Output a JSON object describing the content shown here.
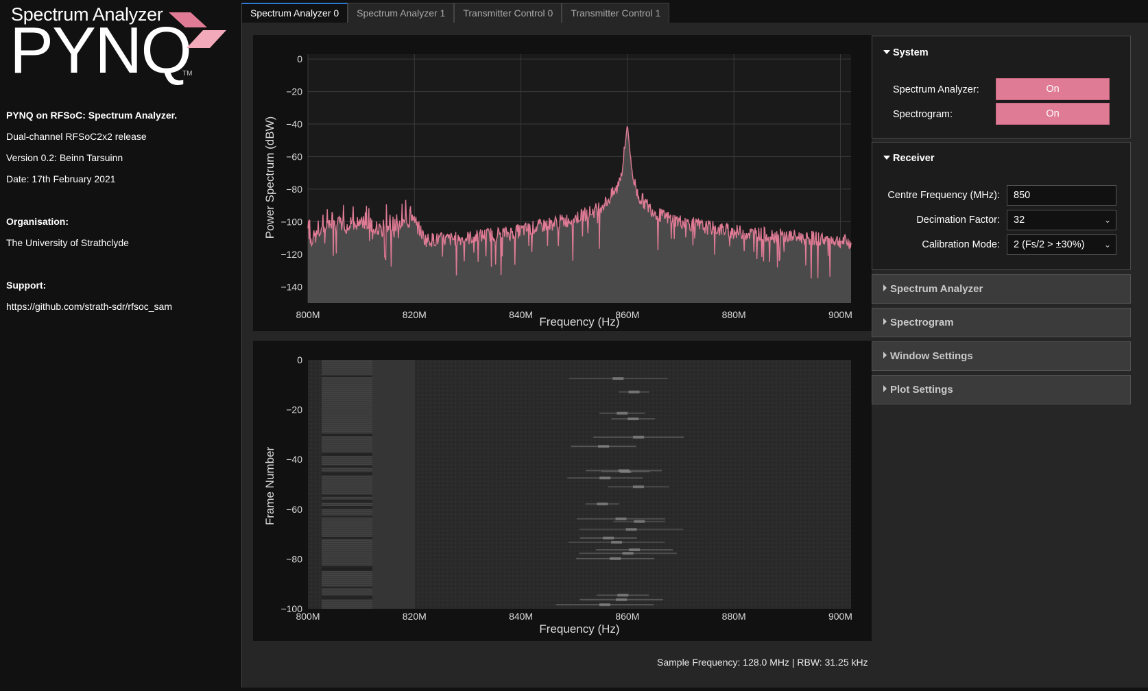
{
  "sidebar": {
    "logo_subtitle": "Spectrum Analyzer",
    "logo_title": "PYNQ",
    "logo_tm": "TM",
    "project_title": "PYNQ on RFSoC: Spectrum Analyzer.",
    "release": "Dual-channel RFSoC2x2 release",
    "version": "Version 0.2: Beinn Tarsuinn",
    "date": "Date: 17th February 2021",
    "organisation_label": "Organisation:",
    "organisation": "The University of Strathclyde",
    "support_label": "Support:",
    "support_url": "https://github.com/strath-sdr/rfsoc_sam"
  },
  "tabs": [
    {
      "label": "Spectrum Analyzer 0",
      "active": true
    },
    {
      "label": "Spectrum Analyzer 1",
      "active": false
    },
    {
      "label": "Transmitter Control 0",
      "active": false
    },
    {
      "label": "Transmitter Control 1",
      "active": false
    }
  ],
  "colors": {
    "trace": "#e07b95",
    "fill": "#4a4a4a",
    "plot_bg": "#111111",
    "panel_bg": "#262626",
    "toggle_on": "#e07b95",
    "active_tab_accent": "#2f7ad1"
  },
  "chart_data": [
    {
      "type": "line",
      "ylabel": "Power Spectrum (dBW)",
      "xlabel": "Frequency (Hz)",
      "xlim": [
        800,
        902
      ],
      "ylim": [
        -150,
        3
      ],
      "x_ticks": [
        800,
        820,
        840,
        860,
        880,
        900
      ],
      "x_tick_labels": [
        "800M",
        "820M",
        "840M",
        "860M",
        "880M",
        "900M"
      ],
      "y_ticks": [
        0,
        -20,
        -40,
        -60,
        -80,
        -100,
        -120,
        -140
      ],
      "y_tick_labels": [
        "0",
        "−20",
        "−40",
        "−60",
        "−80",
        "−100",
        "−120",
        "−140"
      ],
      "grid": true,
      "series": [
        {
          "x": [
            800,
            802,
            804,
            806,
            808,
            810,
            812,
            814,
            816,
            818,
            820,
            822,
            826,
            830,
            834,
            838,
            842,
            846,
            850,
            854,
            856,
            858,
            859,
            859.5,
            860,
            860.5,
            861,
            862,
            864,
            866,
            870,
            874,
            878,
            882,
            886,
            890,
            894,
            898,
            902
          ],
          "y": [
            -112,
            -108,
            -102,
            -101,
            -104,
            -100,
            -102,
            -106,
            -103,
            -101,
            -99,
            -111,
            -111,
            -110,
            -108,
            -107,
            -104,
            -101,
            -98,
            -93,
            -88,
            -80,
            -68,
            -55,
            -40,
            -58,
            -72,
            -84,
            -91,
            -96,
            -100,
            -103,
            -105,
            -107,
            -108,
            -109,
            -110,
            -111,
            -113
          ]
        }
      ]
    },
    {
      "type": "heatmap",
      "ylabel": "Frame Number",
      "xlabel": "Frequency (Hz)",
      "xlim": [
        800,
        902
      ],
      "ylim": [
        -100,
        0
      ],
      "x_ticks": [
        800,
        820,
        840,
        860,
        880,
        900
      ],
      "x_tick_labels": [
        "800M",
        "820M",
        "840M",
        "860M",
        "880M",
        "900M"
      ],
      "y_ticks": [
        0,
        -20,
        -40,
        -60,
        -80,
        -100
      ],
      "y_tick_labels": [
        "0",
        "−20",
        "−40",
        "−60",
        "−80",
        "−100"
      ],
      "grid": false
    }
  ],
  "status": "Sample Frequency: 128.0 MHz | RBW: 31.25 kHz",
  "system": {
    "title": "System",
    "spectrum_analyzer_label": "Spectrum Analyzer:",
    "spectrum_analyzer_value": "On",
    "spectrogram_label": "Spectrogram:",
    "spectrogram_value": "On"
  },
  "receiver": {
    "title": "Receiver",
    "centre_label": "Centre Frequency (MHz):",
    "centre_value": "850",
    "decimation_label": "Decimation Factor:",
    "decimation_value": "32",
    "calibration_label": "Calibration Mode:",
    "calibration_value": "2 (Fs/2 > ±30%)"
  },
  "sections": [
    {
      "label": "Spectrum Analyzer"
    },
    {
      "label": "Spectrogram"
    },
    {
      "label": "Window Settings"
    },
    {
      "label": "Plot Settings"
    }
  ]
}
